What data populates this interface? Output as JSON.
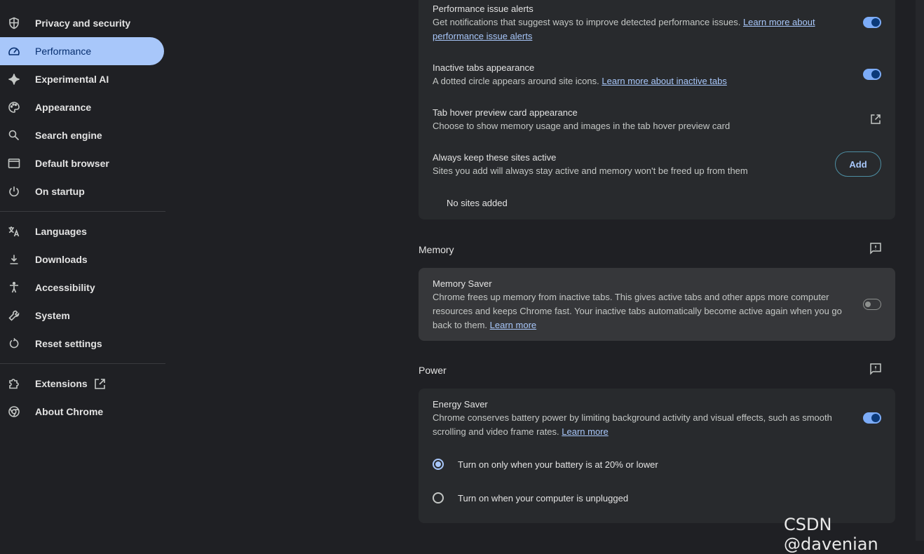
{
  "sidebar": {
    "items": [
      {
        "label": "Privacy and security",
        "icon": "shield-icon"
      },
      {
        "label": "Performance",
        "icon": "speedometer-icon",
        "active": true
      },
      {
        "label": "Experimental AI",
        "icon": "sparkle-icon"
      },
      {
        "label": "Appearance",
        "icon": "palette-icon"
      },
      {
        "label": "Search engine",
        "icon": "search-icon"
      },
      {
        "label": "Default browser",
        "icon": "browser-window-icon"
      },
      {
        "label": "On startup",
        "icon": "power-icon"
      },
      {
        "label": "Languages",
        "icon": "translate-icon"
      },
      {
        "label": "Downloads",
        "icon": "download-icon"
      },
      {
        "label": "Accessibility",
        "icon": "accessibility-icon"
      },
      {
        "label": "System",
        "icon": "wrench-icon"
      },
      {
        "label": "Reset settings",
        "icon": "reset-icon"
      },
      {
        "label": "Extensions",
        "icon": "puzzle-icon"
      },
      {
        "label": "About Chrome",
        "icon": "chrome-icon"
      }
    ]
  },
  "tabs_card": {
    "alerts": {
      "title": "Performance issue alerts",
      "desc": "Get notifications that suggest ways to improve detected performance issues. ",
      "link": "Learn more about performance issue alerts",
      "enabled": true
    },
    "inactive": {
      "title": "Inactive tabs appearance",
      "desc": "A dotted circle appears around site icons. ",
      "link": "Learn more about inactive tabs",
      "enabled": true
    },
    "hover": {
      "title": "Tab hover preview card appearance",
      "desc": "Choose to show memory usage and images in the tab hover preview card"
    },
    "keep_active": {
      "title": "Always keep these sites active",
      "desc": "Sites you add will always stay active and memory won't be freed up from them",
      "add_label": "Add",
      "empty": "No sites added"
    }
  },
  "memory": {
    "section_title": "Memory",
    "saver_title": "Memory Saver",
    "saver_desc": "Chrome frees up memory from inactive tabs. This gives active tabs and other apps more computer resources and keeps Chrome fast. Your inactive tabs automatically become active again when you go back to them. ",
    "saver_link": "Learn more",
    "enabled": false
  },
  "power": {
    "section_title": "Power",
    "energy_title": "Energy Saver",
    "energy_desc": "Chrome conserves battery power by limiting background activity and visual effects, such as smooth scrolling and video frame rates. ",
    "energy_link": "Learn more",
    "enabled": true,
    "options": [
      {
        "label": "Turn on only when your battery is at 20% or lower",
        "selected": true
      },
      {
        "label": "Turn on when your computer is unplugged",
        "selected": false
      }
    ]
  },
  "watermark": "CSDN @davenian",
  "colors": {
    "accent": "#a8c7fa",
    "background": "#1f2024",
    "card": "#282a2d"
  }
}
